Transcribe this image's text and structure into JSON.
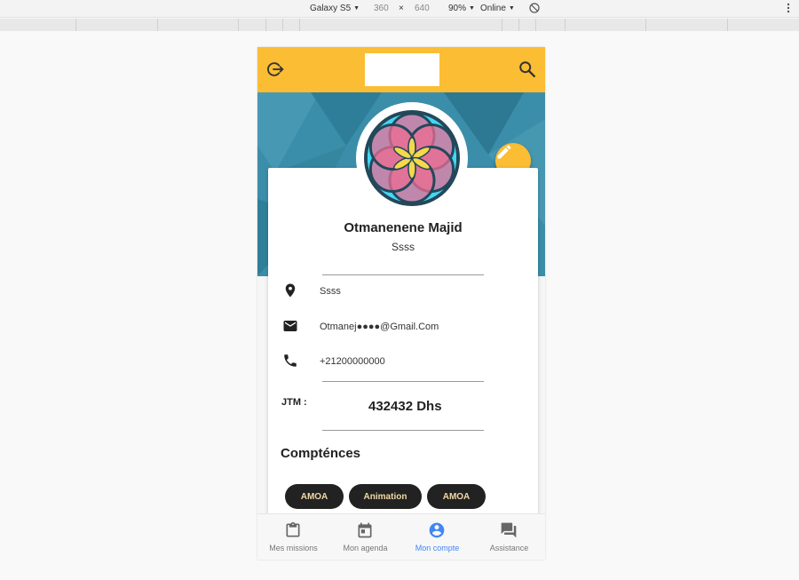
{
  "devtools": {
    "device": "Galaxy S5",
    "width": "360",
    "times": "×",
    "height": "640",
    "zoom": "90%",
    "network": "Online",
    "menu_icon": "more-vert-icon",
    "rotate_icon": "rotate-icon"
  },
  "appbar": {
    "logout_icon": "logout-icon",
    "search_icon": "search-icon",
    "color": "#fbbd33"
  },
  "profile": {
    "name": "Otmanenene Majid",
    "subtitle": "Ssss",
    "edit_icon": "pencil-icon",
    "avatar_icon": "flower-of-life-avatar"
  },
  "info": {
    "location": "Ssss",
    "email": "Otmanej●●●●@Gmail.Com",
    "phone": "+21200000000"
  },
  "jtm": {
    "label": "JTM :",
    "value": "432432 Dhs"
  },
  "skills": {
    "title": "Compténces",
    "chips": [
      "AMOA",
      "Animation",
      "AMOA"
    ]
  },
  "bottom_nav": {
    "items": [
      {
        "label": "Mes missions",
        "icon": "clipboard-icon",
        "active": false
      },
      {
        "label": "Mon agenda",
        "icon": "calendar-icon",
        "active": false
      },
      {
        "label": "Mon compte",
        "icon": "account-circle-icon",
        "active": true
      },
      {
        "label": "Assistance",
        "icon": "chat-icon",
        "active": false
      }
    ],
    "active_color": "#4285f4"
  }
}
